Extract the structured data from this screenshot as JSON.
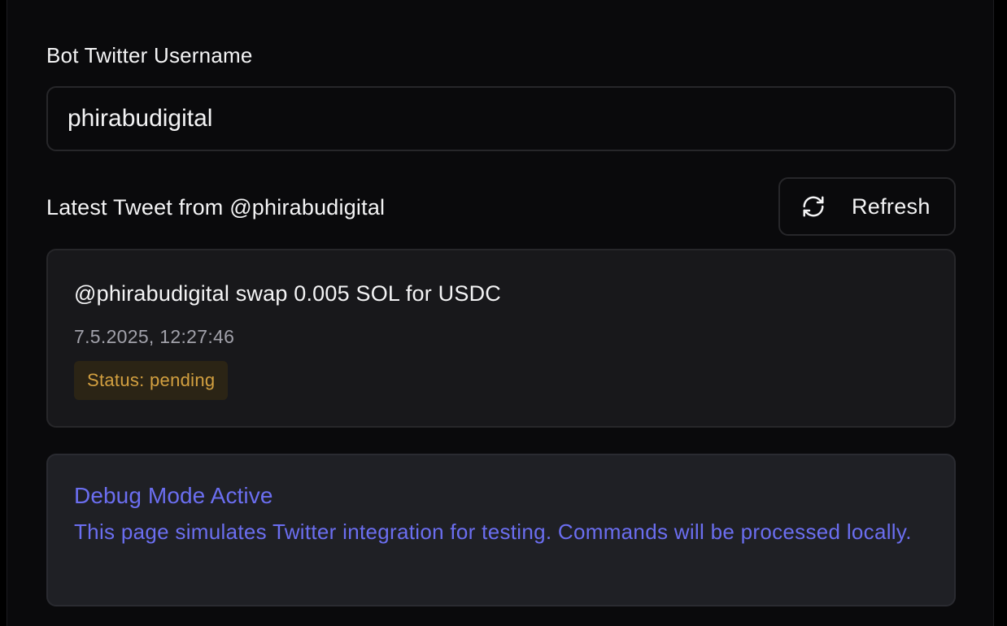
{
  "form": {
    "username_label": "Bot Twitter Username",
    "username_value": "phirabudigital"
  },
  "tweet_section": {
    "heading": "Latest Tweet from @phirabudigital",
    "refresh_label": "Refresh",
    "refresh_icon": "refresh-icon",
    "tweet": {
      "text": "@phirabudigital swap 0.005 SOL for USDC",
      "timestamp": "7.5.2025, 12:27:46",
      "status": "Status: pending"
    }
  },
  "debug": {
    "title": "Debug Mode Active",
    "message": "This page simulates Twitter integration for testing. Commands will be processed locally."
  },
  "colors": {
    "background": "#0a0a0c",
    "card": "#18181b",
    "border": "#27272a",
    "status_text": "#d3a040",
    "status_bg": "#2b2415",
    "debug_accent": "#6b6ef0"
  }
}
